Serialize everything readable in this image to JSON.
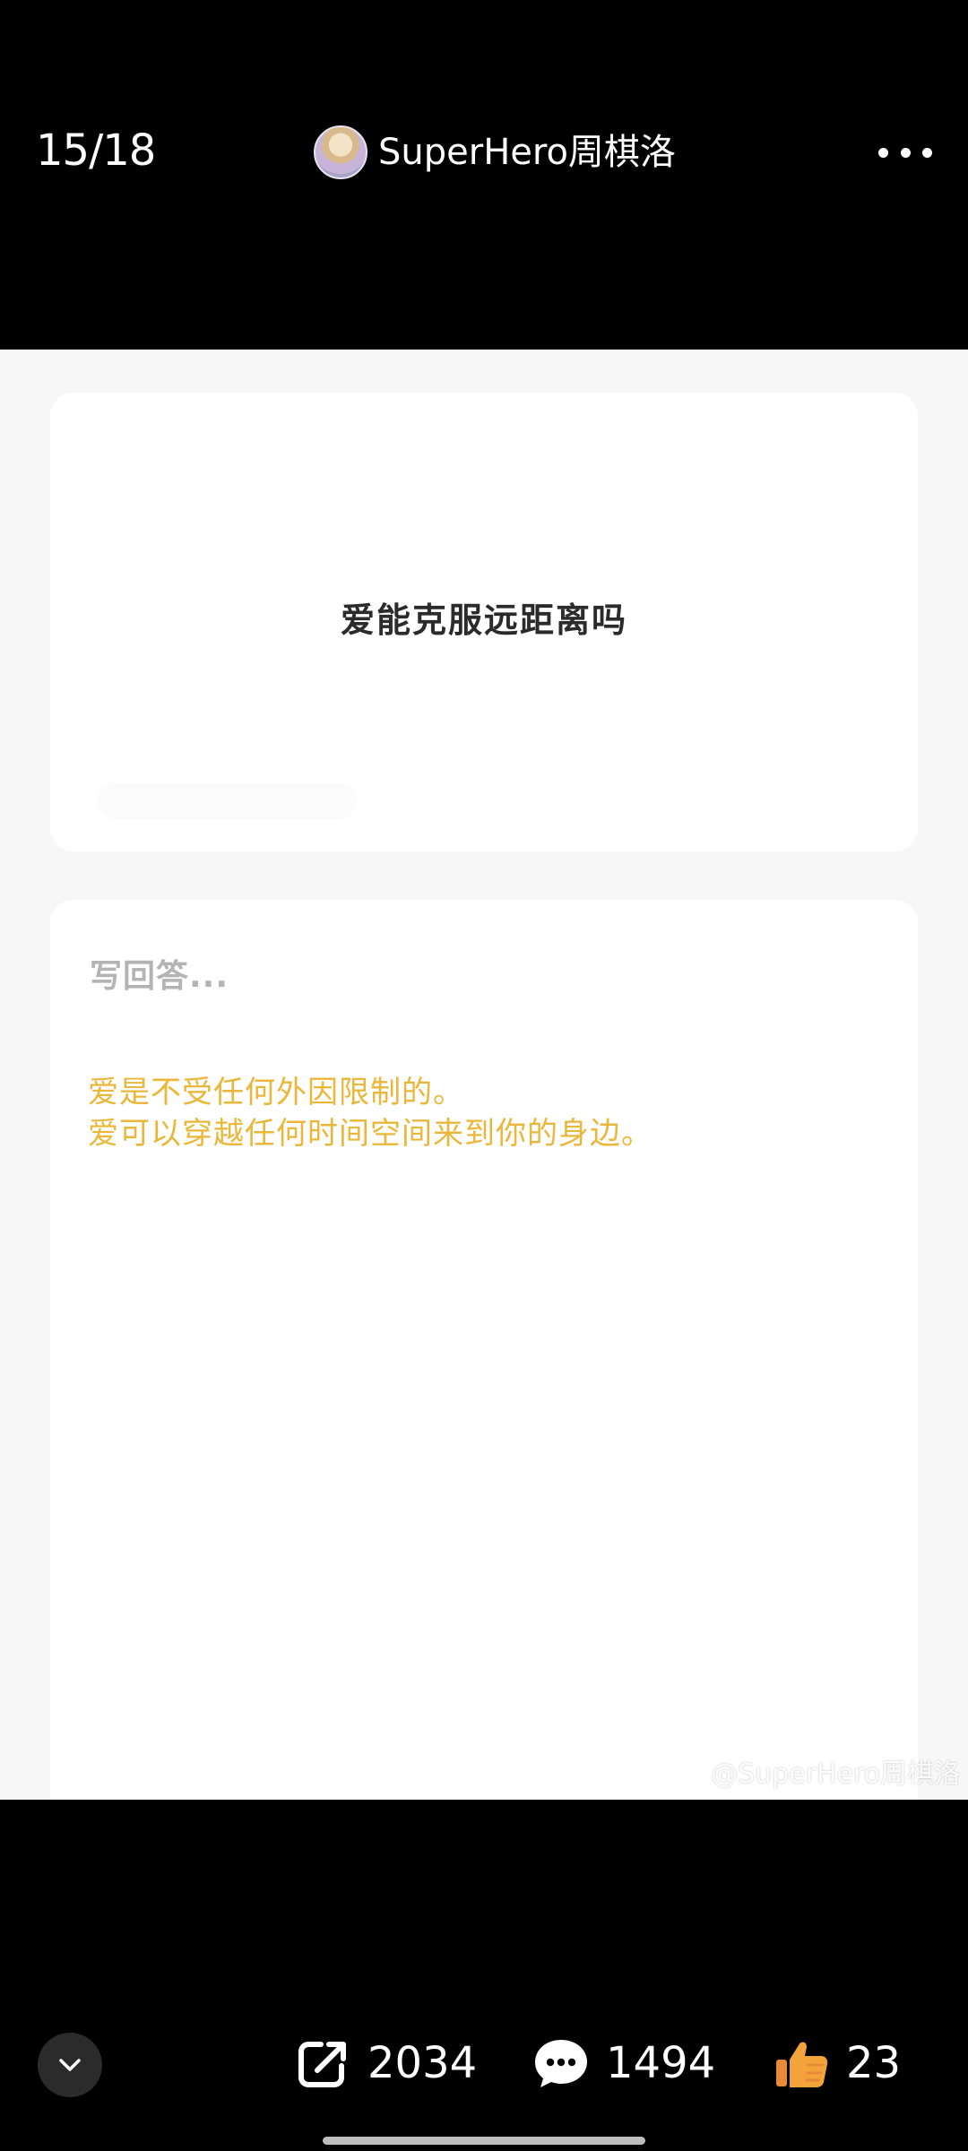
{
  "header": {
    "counter": "15/18",
    "author_name": "SuperHero周棋洛",
    "more_icon": "more-dots-icon"
  },
  "question": {
    "text": "爱能克服远距离吗"
  },
  "answer": {
    "placeholder": "写回答...",
    "lines": [
      "爱是不受任何外因限制的。",
      "爱可以穿越任何时间空间来到你的身边。"
    ],
    "text_color": "#eab73a"
  },
  "watermark": {
    "text": "@SuperHero周棋洛",
    "icon": "weibo-icon"
  },
  "toolbar": {
    "collapse_icon": "chevron-down-icon",
    "share_count": "2034",
    "comment_count": "1494",
    "like_count": "23",
    "like_color": "#f2a33a"
  }
}
